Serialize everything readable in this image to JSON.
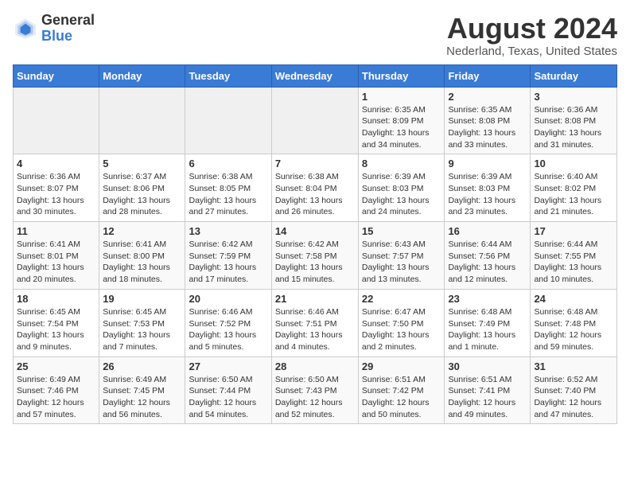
{
  "logo": {
    "general": "General",
    "blue": "Blue"
  },
  "header": {
    "title": "August 2024",
    "subtitle": "Nederland, Texas, United States"
  },
  "weekdays": [
    "Sunday",
    "Monday",
    "Tuesday",
    "Wednesday",
    "Thursday",
    "Friday",
    "Saturday"
  ],
  "weeks": [
    [
      {
        "day": "",
        "info": ""
      },
      {
        "day": "",
        "info": ""
      },
      {
        "day": "",
        "info": ""
      },
      {
        "day": "",
        "info": ""
      },
      {
        "day": "1",
        "info": "Sunrise: 6:35 AM\nSunset: 8:09 PM\nDaylight: 13 hours\nand 34 minutes."
      },
      {
        "day": "2",
        "info": "Sunrise: 6:35 AM\nSunset: 8:08 PM\nDaylight: 13 hours\nand 33 minutes."
      },
      {
        "day": "3",
        "info": "Sunrise: 6:36 AM\nSunset: 8:08 PM\nDaylight: 13 hours\nand 31 minutes."
      }
    ],
    [
      {
        "day": "4",
        "info": "Sunrise: 6:36 AM\nSunset: 8:07 PM\nDaylight: 13 hours\nand 30 minutes."
      },
      {
        "day": "5",
        "info": "Sunrise: 6:37 AM\nSunset: 8:06 PM\nDaylight: 13 hours\nand 28 minutes."
      },
      {
        "day": "6",
        "info": "Sunrise: 6:38 AM\nSunset: 8:05 PM\nDaylight: 13 hours\nand 27 minutes."
      },
      {
        "day": "7",
        "info": "Sunrise: 6:38 AM\nSunset: 8:04 PM\nDaylight: 13 hours\nand 26 minutes."
      },
      {
        "day": "8",
        "info": "Sunrise: 6:39 AM\nSunset: 8:03 PM\nDaylight: 13 hours\nand 24 minutes."
      },
      {
        "day": "9",
        "info": "Sunrise: 6:39 AM\nSunset: 8:03 PM\nDaylight: 13 hours\nand 23 minutes."
      },
      {
        "day": "10",
        "info": "Sunrise: 6:40 AM\nSunset: 8:02 PM\nDaylight: 13 hours\nand 21 minutes."
      }
    ],
    [
      {
        "day": "11",
        "info": "Sunrise: 6:41 AM\nSunset: 8:01 PM\nDaylight: 13 hours\nand 20 minutes."
      },
      {
        "day": "12",
        "info": "Sunrise: 6:41 AM\nSunset: 8:00 PM\nDaylight: 13 hours\nand 18 minutes."
      },
      {
        "day": "13",
        "info": "Sunrise: 6:42 AM\nSunset: 7:59 PM\nDaylight: 13 hours\nand 17 minutes."
      },
      {
        "day": "14",
        "info": "Sunrise: 6:42 AM\nSunset: 7:58 PM\nDaylight: 13 hours\nand 15 minutes."
      },
      {
        "day": "15",
        "info": "Sunrise: 6:43 AM\nSunset: 7:57 PM\nDaylight: 13 hours\nand 13 minutes."
      },
      {
        "day": "16",
        "info": "Sunrise: 6:44 AM\nSunset: 7:56 PM\nDaylight: 13 hours\nand 12 minutes."
      },
      {
        "day": "17",
        "info": "Sunrise: 6:44 AM\nSunset: 7:55 PM\nDaylight: 13 hours\nand 10 minutes."
      }
    ],
    [
      {
        "day": "18",
        "info": "Sunrise: 6:45 AM\nSunset: 7:54 PM\nDaylight: 13 hours\nand 9 minutes."
      },
      {
        "day": "19",
        "info": "Sunrise: 6:45 AM\nSunset: 7:53 PM\nDaylight: 13 hours\nand 7 minutes."
      },
      {
        "day": "20",
        "info": "Sunrise: 6:46 AM\nSunset: 7:52 PM\nDaylight: 13 hours\nand 5 minutes."
      },
      {
        "day": "21",
        "info": "Sunrise: 6:46 AM\nSunset: 7:51 PM\nDaylight: 13 hours\nand 4 minutes."
      },
      {
        "day": "22",
        "info": "Sunrise: 6:47 AM\nSunset: 7:50 PM\nDaylight: 13 hours\nand 2 minutes."
      },
      {
        "day": "23",
        "info": "Sunrise: 6:48 AM\nSunset: 7:49 PM\nDaylight: 13 hours\nand 1 minute."
      },
      {
        "day": "24",
        "info": "Sunrise: 6:48 AM\nSunset: 7:48 PM\nDaylight: 12 hours\nand 59 minutes."
      }
    ],
    [
      {
        "day": "25",
        "info": "Sunrise: 6:49 AM\nSunset: 7:46 PM\nDaylight: 12 hours\nand 57 minutes."
      },
      {
        "day": "26",
        "info": "Sunrise: 6:49 AM\nSunset: 7:45 PM\nDaylight: 12 hours\nand 56 minutes."
      },
      {
        "day": "27",
        "info": "Sunrise: 6:50 AM\nSunset: 7:44 PM\nDaylight: 12 hours\nand 54 minutes."
      },
      {
        "day": "28",
        "info": "Sunrise: 6:50 AM\nSunset: 7:43 PM\nDaylight: 12 hours\nand 52 minutes."
      },
      {
        "day": "29",
        "info": "Sunrise: 6:51 AM\nSunset: 7:42 PM\nDaylight: 12 hours\nand 50 minutes."
      },
      {
        "day": "30",
        "info": "Sunrise: 6:51 AM\nSunset: 7:41 PM\nDaylight: 12 hours\nand 49 minutes."
      },
      {
        "day": "31",
        "info": "Sunrise: 6:52 AM\nSunset: 7:40 PM\nDaylight: 12 hours\nand 47 minutes."
      }
    ]
  ]
}
